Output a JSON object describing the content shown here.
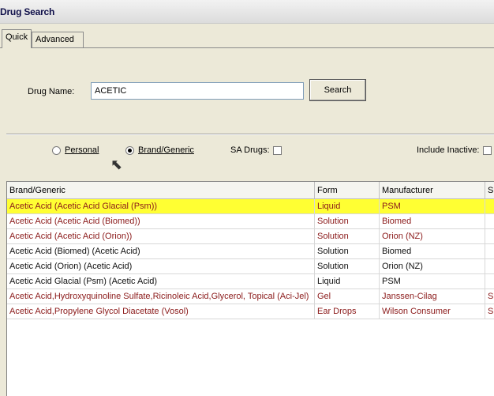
{
  "window": {
    "title": "Drug Search"
  },
  "tabs": [
    {
      "label": "Quick",
      "active": true
    },
    {
      "label": "Advanced",
      "active": false
    }
  ],
  "search": {
    "label": "Drug Name:",
    "value": "ACETIC",
    "button_label": "Search"
  },
  "filters": {
    "personal_label": "Personal",
    "brand_generic_label": "Brand/Generic",
    "sa_drugs_label": "SA Drugs:",
    "include_inactive_label": "Include Inactive:",
    "selected_radio": "Brand/Generic"
  },
  "table": {
    "columns": [
      "Brand/Generic",
      "Form",
      "Manufacturer",
      "Sub"
    ],
    "rows": [
      {
        "name": "Acetic Acid (Acetic Acid Glacial (Psm))",
        "form": "Liquid",
        "manufacturer": "PSM",
        "sub": "",
        "color": "red",
        "selected": true
      },
      {
        "name": "Acetic Acid (Acetic Acid (Biomed))",
        "form": "Solution",
        "manufacturer": "Biomed",
        "sub": "",
        "color": "red",
        "selected": false
      },
      {
        "name": "Acetic Acid (Acetic Acid (Orion))",
        "form": "Solution",
        "manufacturer": "Orion (NZ)",
        "sub": "",
        "color": "red",
        "selected": false
      },
      {
        "name": "Acetic Acid (Biomed) (Acetic Acid)",
        "form": "Solution",
        "manufacturer": "Biomed",
        "sub": "",
        "color": "dark",
        "selected": false
      },
      {
        "name": "Acetic Acid (Orion) (Acetic Acid)",
        "form": "Solution",
        "manufacturer": "Orion (NZ)",
        "sub": "",
        "color": "dark",
        "selected": false
      },
      {
        "name": "Acetic Acid Glacial (Psm) (Acetic Acid)",
        "form": "Liquid",
        "manufacturer": "PSM",
        "sub": "",
        "color": "dark",
        "selected": false
      },
      {
        "name": "Acetic Acid,Hydroxyquinoline Sulfate,Ricinoleic Acid,Glycerol,  Topical (Aci-Jel)",
        "form": "Gel",
        "manufacturer": "Janssen-Cilag",
        "sub": "S",
        "color": "red",
        "selected": false
      },
      {
        "name": "Acetic Acid,Propylene Glycol Diacetate (Vosol)",
        "form": "Ear Drops",
        "manufacturer": "Wilson Consumer",
        "sub": "S",
        "color": "red",
        "selected": false
      }
    ]
  },
  "colors": {
    "selected_row": "#ffff33",
    "brand_text": "#8b1a1a",
    "generic_text": "#111111"
  }
}
